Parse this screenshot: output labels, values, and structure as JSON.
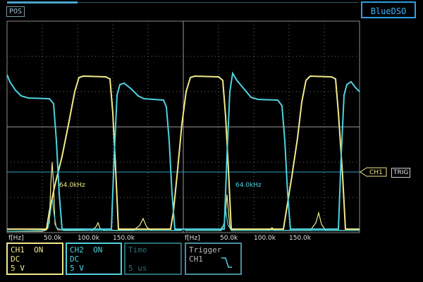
{
  "header": {
    "pos_label": "POS",
    "brand": "BlueDSO"
  },
  "trigger_marker": {
    "ch_label": "CH1",
    "trig_label": "TRIG"
  },
  "fft": {
    "axis_label": "f[Hz]",
    "ticks": [
      "50.0k",
      "100.0k",
      "150.0k"
    ],
    "peak_label": "64.0kHz"
  },
  "panels": {
    "ch1": {
      "name": "CH1",
      "state": "ON",
      "coupling": "DC",
      "scale": "5 V"
    },
    "ch2": {
      "name": "CH2",
      "state": "ON",
      "coupling": "DC",
      "scale": "5 V"
    },
    "time": {
      "name": "Time",
      "value": "5 us"
    },
    "trigger": {
      "name": "Trigger",
      "source": "CH1",
      "slope_icon": "falling-edge-icon"
    }
  },
  "colors": {
    "ch1": "#f1ea89",
    "ch2": "#4dd3e0",
    "grid": "#7a7a7a",
    "trigger_line": "#2ea0c4"
  }
}
